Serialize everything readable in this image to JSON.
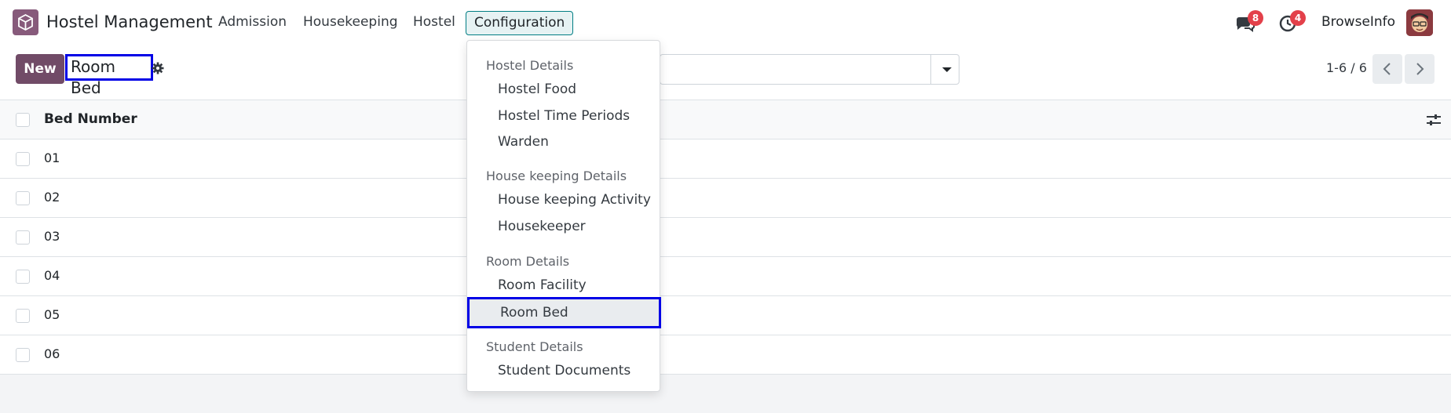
{
  "navbar": {
    "brand": "Hostel Management",
    "menus": [
      "Admission",
      "Housekeeping",
      "Hostel",
      "Configuration"
    ],
    "messages_count": "8",
    "activities_count": "4",
    "user": "BrowseInfo"
  },
  "control_panel": {
    "new_label": "New",
    "title": "Room Bed",
    "pager": "1-6 / 6"
  },
  "list": {
    "column": "Bed Number",
    "rows": [
      "01",
      "02",
      "03",
      "04",
      "05",
      "06"
    ]
  },
  "dropdown": {
    "sections": [
      {
        "header": "Hostel Details",
        "items": [
          "Hostel Food",
          "Hostel Time Periods",
          "Warden"
        ]
      },
      {
        "header": "House keeping Details",
        "items": [
          "House keeping Activity",
          "Housekeeper"
        ]
      },
      {
        "header": "Room Details",
        "items": [
          "Room Facility",
          "Room Bed"
        ]
      },
      {
        "header": "Student Details",
        "items": [
          "Student Documents"
        ]
      }
    ]
  },
  "colors": {
    "brand": "#714b67",
    "highlight_border": "#0000e6",
    "badge": "#e3404a"
  }
}
